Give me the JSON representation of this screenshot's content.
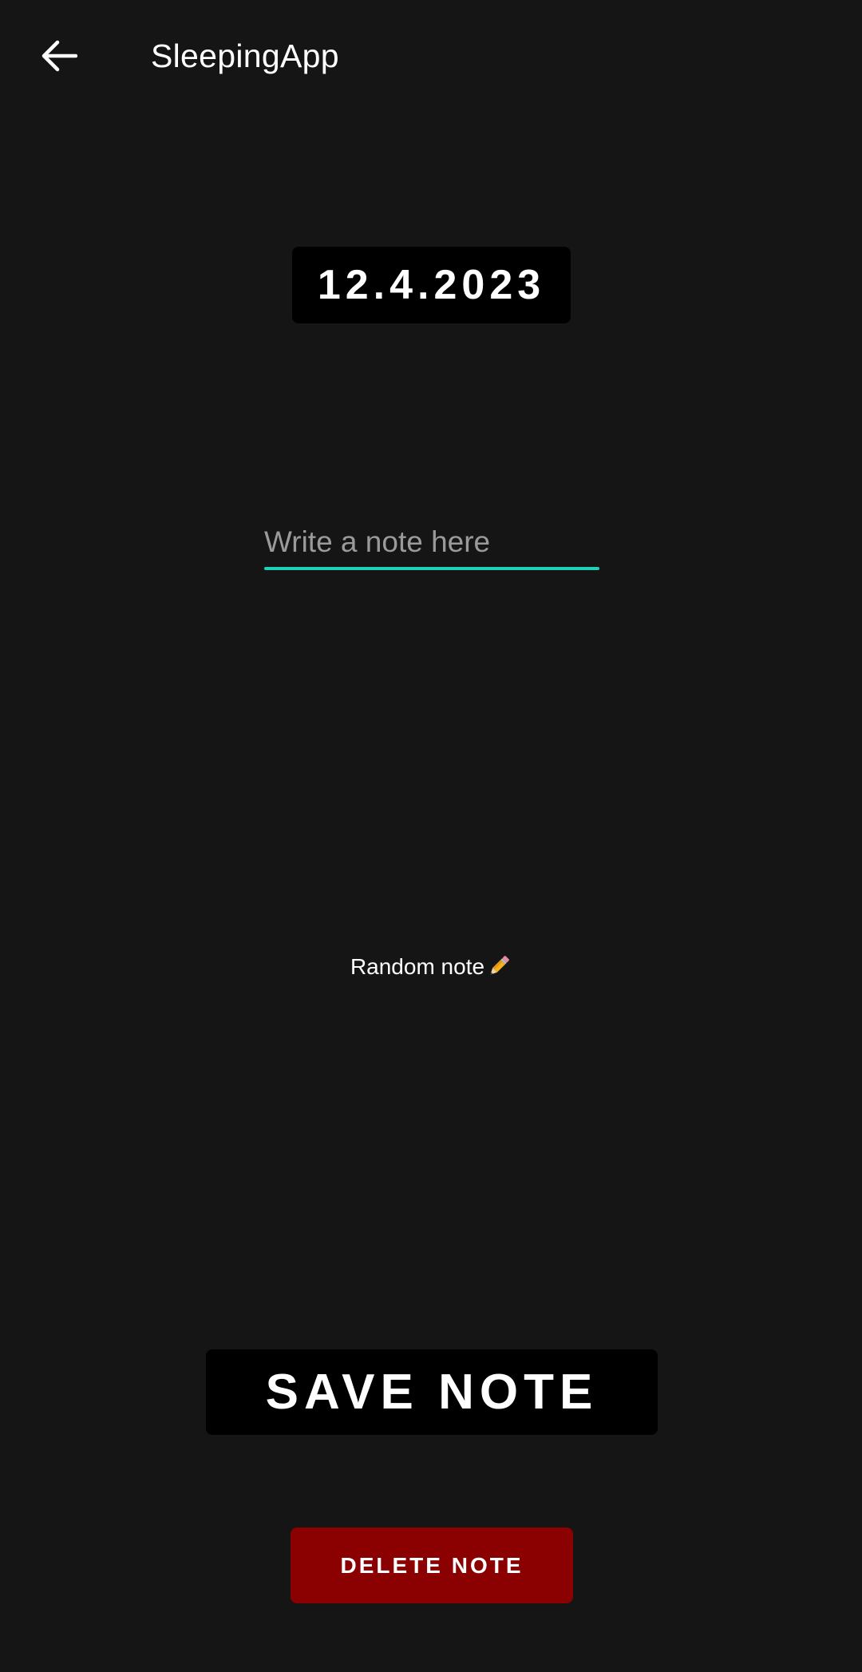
{
  "app": {
    "title": "SleepingApp",
    "back_icon": "arrow-left-icon"
  },
  "date": {
    "value": "12.4.2023"
  },
  "note_input": {
    "value": "",
    "placeholder": "Write a note here"
  },
  "note_label": {
    "text": "Random note",
    "icon": "pencil-icon"
  },
  "actions": {
    "save_label": "SAVE NOTE",
    "delete_label": "DELETE NOTE"
  },
  "colors": {
    "background": "#151515",
    "accent": "#1fd1b8",
    "danger": "#8b0000",
    "button_dark": "#000000"
  }
}
